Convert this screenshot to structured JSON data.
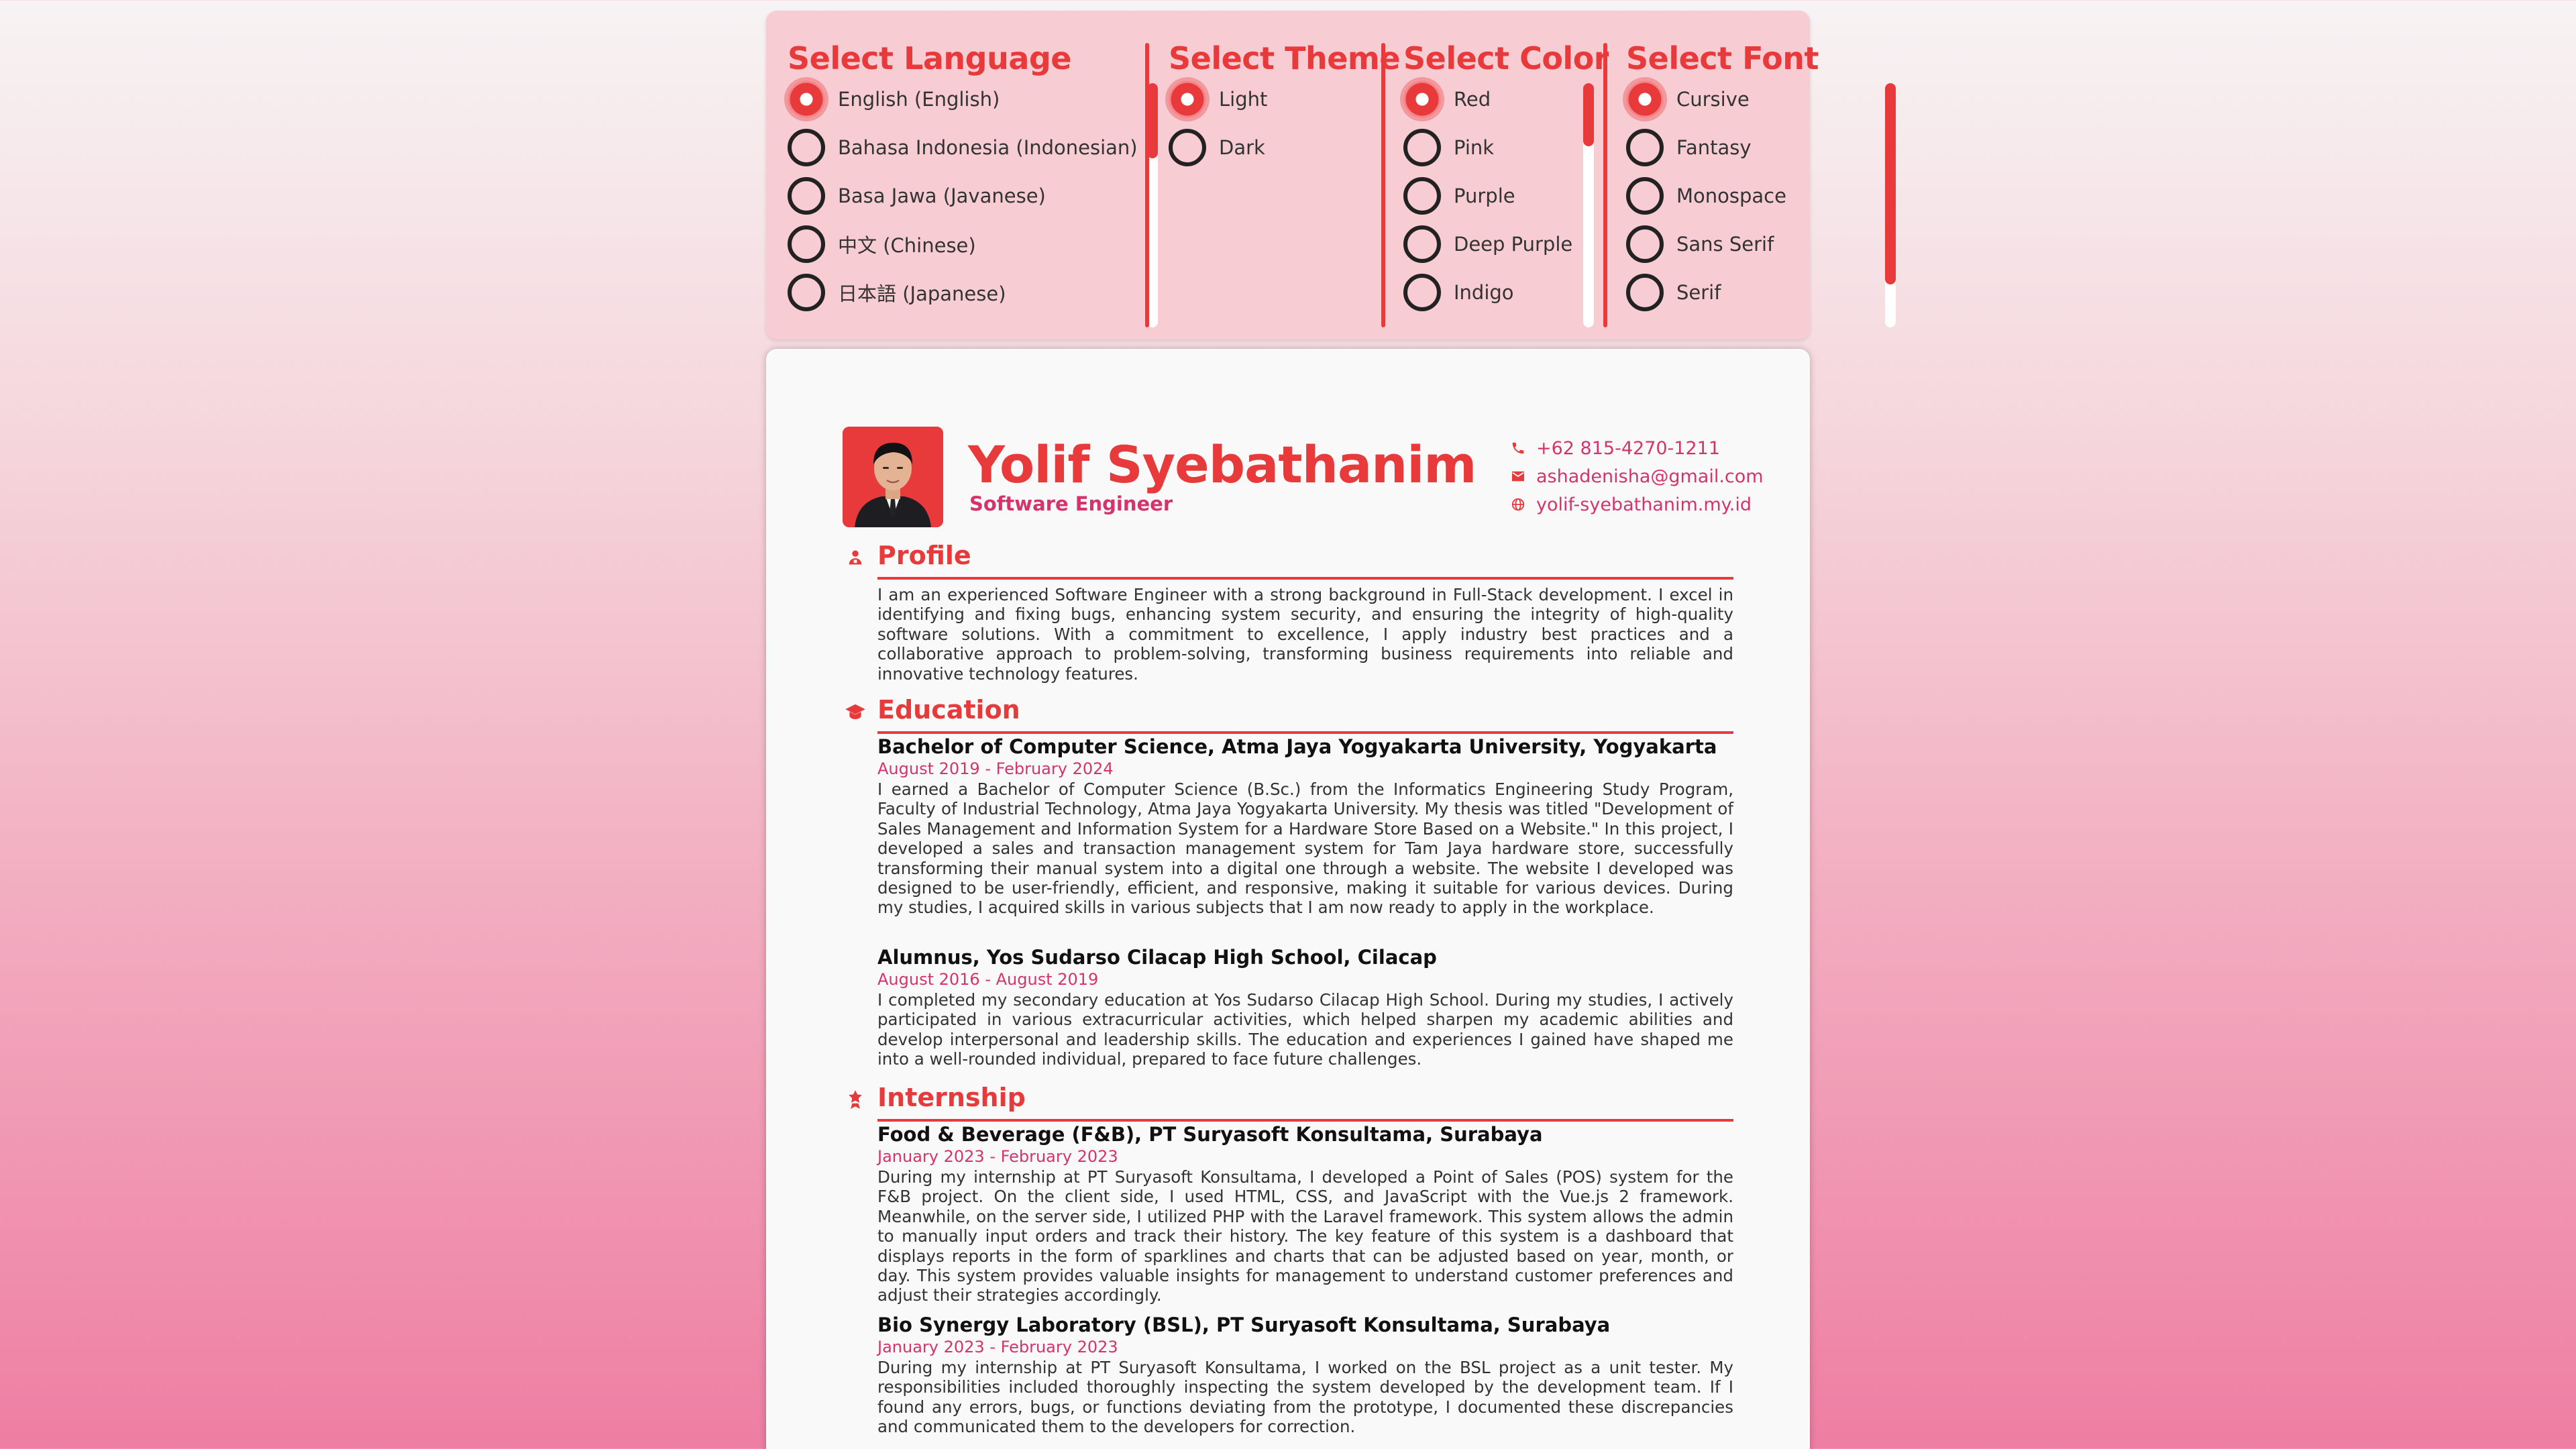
{
  "selector": {
    "language": {
      "title": "Select Language",
      "options": [
        "English (English)",
        "Bahasa Indonesia (Indonesian)",
        "Basa Jawa (Javanese)",
        "中文 (Chinese)",
        "日本語 (Japanese)"
      ],
      "selected": "English (English)"
    },
    "theme": {
      "title": "Select Theme",
      "options": [
        "Light",
        "Dark"
      ],
      "selected": "Light"
    },
    "color": {
      "title": "Select Color",
      "options": [
        "Red",
        "Pink",
        "Purple",
        "Deep Purple",
        "Indigo"
      ],
      "selected": "Red"
    },
    "font": {
      "title": "Select Font",
      "options": [
        "Cursive",
        "Fantasy",
        "Monospace",
        "Sans Serif",
        "Serif"
      ],
      "selected": "Cursive"
    }
  },
  "resume": {
    "name": "Yolif Syebathanim",
    "job_title": "Software Engineer",
    "contacts": {
      "phone": "+62 815-4270-1211",
      "email": "ashadenisha@gmail.com",
      "website": "yolif-syebathanim.my.id"
    },
    "profile": {
      "title": "Profile",
      "text": "I am an experienced Software Engineer with a strong background in Full-Stack development. I excel in identifying and fixing bugs, enhancing system security, and ensuring the integrity of high-quality software solutions. With a commitment to excellence, I apply industry best practices and a collaborative approach to problem-solving, transforming business requirements into reliable and innovative technology features."
    },
    "education": {
      "title": "Education",
      "entries": [
        {
          "title": "Bachelor of Computer Science, Atma Jaya Yogyakarta University, Yogyakarta",
          "date": "August 2019 - February 2024",
          "text": "I earned a Bachelor of Computer Science (B.Sc.) from the Informatics Engineering Study Program, Faculty of Industrial Technology, Atma Jaya Yogyakarta University. My thesis was titled \"Development of Sales Management and Information System for a Hardware Store Based on a Website.\" In this project, I developed a sales and transaction management system for Tam Jaya hardware store, successfully transforming their manual system into a digital one through a website. The website I developed was designed to be user-friendly, efficient, and responsive, making it suitable for various devices. During my studies, I acquired skills in various subjects that I am now ready to apply in the workplace."
        },
        {
          "title": "Alumnus, Yos Sudarso Cilacap High School, Cilacap",
          "date": "August 2016 - August 2019",
          "text": "I completed my secondary education at Yos Sudarso Cilacap High School. During my studies, I actively participated in various extracurricular activities, which helped sharpen my academic abilities and develop interpersonal and leadership skills. The education and experiences I gained have shaped me into a well-rounded individual, prepared to face future challenges."
        }
      ]
    },
    "internship": {
      "title": "Internship",
      "entries": [
        {
          "title": "Food & Beverage (F&B), PT Suryasoft Konsultama, Surabaya",
          "date": "January 2023 - February 2023",
          "text": "During my internship at PT Suryasoft Konsultama, I developed a Point of Sales (POS) system for the F&B project. On the client side, I used HTML, CSS, and JavaScript with the Vue.js 2 framework. Meanwhile, on the server side, I utilized PHP with the Laravel framework. This system allows the admin to manually input orders and track their history. The key feature of this system is a dashboard that displays reports in the form of sparklines and charts that can be adjusted based on year, month, or day. This system provides valuable insights for management to understand customer preferences and adjust their strategies accordingly."
        },
        {
          "title": "Bio Synergy Laboratory (BSL), PT Suryasoft Konsultama, Surabaya",
          "date": "January 2023 - February 2023",
          "text": "During my internship at PT Suryasoft Konsultama, I worked on the BSL project as a unit tester. My responsibilities included thoroughly inspecting the system developed by the development team. If I found any errors, bugs, or functions deviating from the prototype, I documented these discrepancies and communicated them to the developers for correction."
        }
      ]
    }
  },
  "colors": {
    "accent": "#e8393b",
    "link": "#d6336c",
    "panel": "#f7ccd2",
    "card": "#f9f9f9"
  }
}
